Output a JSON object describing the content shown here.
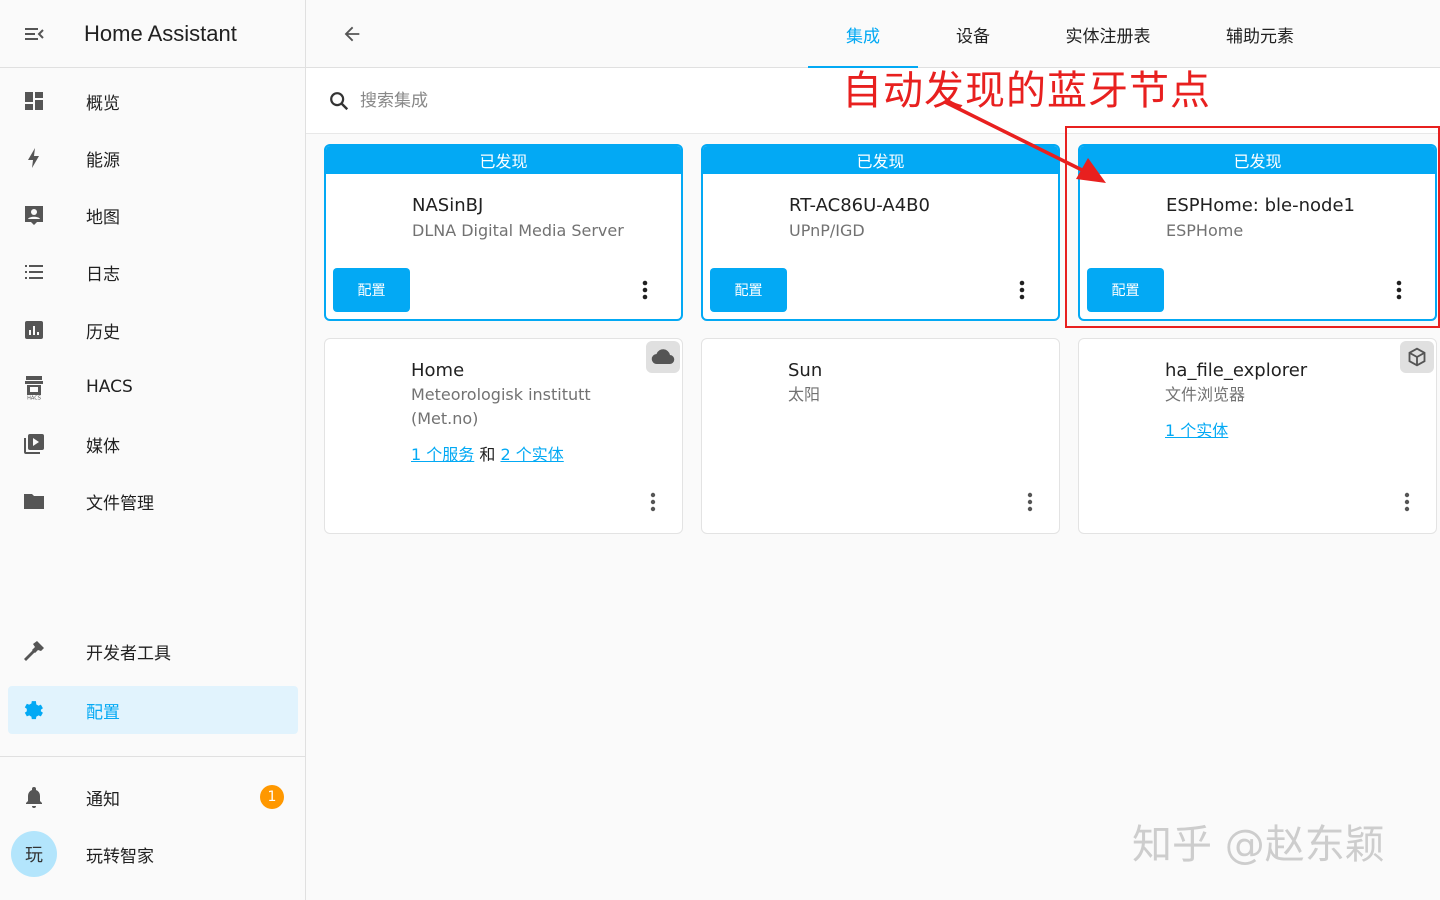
{
  "app": {
    "title": "Home Assistant"
  },
  "sidebar": {
    "items": [
      {
        "label": "概览"
      },
      {
        "label": "能源"
      },
      {
        "label": "地图"
      },
      {
        "label": "日志"
      },
      {
        "label": "历史"
      },
      {
        "label": "HACS"
      },
      {
        "label": "媒体"
      },
      {
        "label": "文件管理"
      }
    ],
    "bottom_items": [
      {
        "label": "开发者工具"
      },
      {
        "label": "配置"
      }
    ],
    "notifications": {
      "label": "通知",
      "count": "1"
    },
    "user": {
      "avatar_text": "玩",
      "name": "玩转智家"
    }
  },
  "tabs": [
    {
      "label": "集成"
    },
    {
      "label": "设备"
    },
    {
      "label": "实体注册表"
    },
    {
      "label": "辅助元素"
    }
  ],
  "search": {
    "placeholder": "搜索集成"
  },
  "annotation": {
    "text": "自动发现的蓝牙节点"
  },
  "discovered_cards": [
    {
      "header": "已发现",
      "title": "NASinBJ",
      "subtitle": "DLNA Digital Media Server",
      "button": "配置"
    },
    {
      "header": "已发现",
      "title": "RT-AC86U-A4B0",
      "subtitle": "UPnP/IGD",
      "button": "配置"
    },
    {
      "header": "已发现",
      "title": "ESPHome: ble-node1",
      "subtitle": "ESPHome",
      "button": "配置"
    }
  ],
  "integration_cards": [
    {
      "title": "Home",
      "subtitle": "Meteorologisk institutt (Met.no)",
      "link1": "1 个服务",
      "joiner": "和",
      "link2": "2 个实体",
      "corner_icon": "cloud-icon"
    },
    {
      "title": "Sun",
      "subtitle": "太阳"
    },
    {
      "title": "ha_file_explorer",
      "subtitle": "文件浏览器",
      "link1": "1 个实体",
      "corner_icon": "package-icon"
    }
  ],
  "watermark": "知乎 @赵东颖",
  "colors": {
    "accent": "#03a9f4",
    "annotation": "#e8201f",
    "badge": "#ff9800"
  }
}
